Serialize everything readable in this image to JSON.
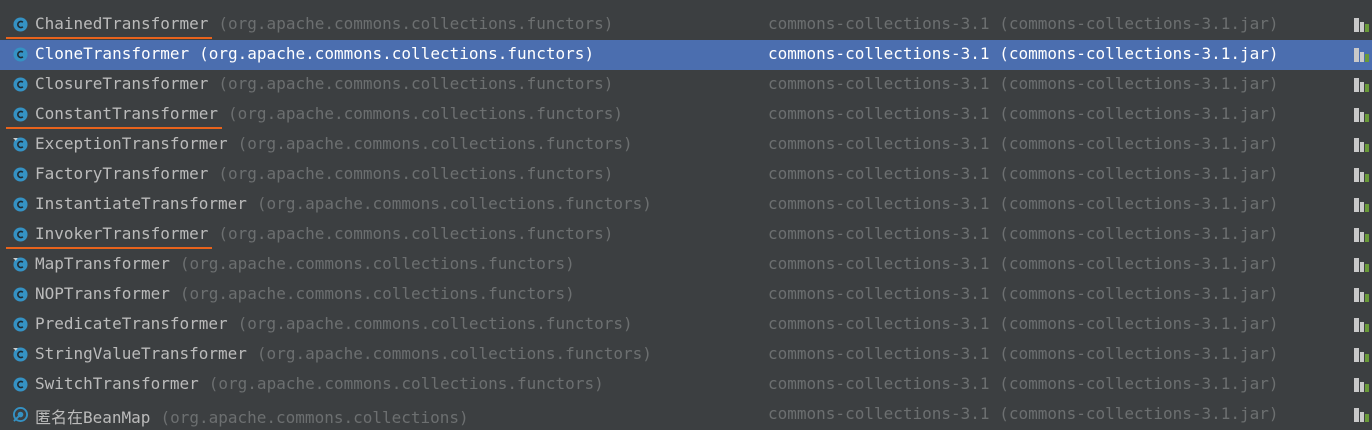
{
  "colors": {
    "background": "#3c3f41",
    "selection": "#4b6eaf",
    "class_icon": "#3592c4",
    "highlight_underline": "#e8631c",
    "primary_text": "#bbbbbb",
    "secondary_text": "#6c6f70"
  },
  "results": [
    {
      "name": "ChainedTransformer",
      "package": "(org.apache.commons.collections.functors)",
      "library": "commons-collections-3.1 (commons-collections-3.1.jar)",
      "icon": "class-icon",
      "selected": false,
      "underlined": true
    },
    {
      "name": "CloneTransformer",
      "package": "(org.apache.commons.collections.functors)",
      "library": "commons-collections-3.1 (commons-collections-3.1.jar)",
      "icon": "class-icon",
      "selected": true,
      "underlined": false
    },
    {
      "name": "ClosureTransformer",
      "package": "(org.apache.commons.collections.functors)",
      "library": "commons-collections-3.1 (commons-collections-3.1.jar)",
      "icon": "class-icon",
      "selected": false,
      "underlined": false
    },
    {
      "name": "ConstantTransformer",
      "package": "(org.apache.commons.collections.functors)",
      "library": "commons-collections-3.1 (commons-collections-3.1.jar)",
      "icon": "class-icon",
      "selected": false,
      "underlined": true
    },
    {
      "name": "ExceptionTransformer",
      "package": "(org.apache.commons.collections.functors)",
      "library": "commons-collections-3.1 (commons-collections-3.1.jar)",
      "icon": "final-class-icon",
      "selected": false,
      "underlined": false
    },
    {
      "name": "FactoryTransformer",
      "package": "(org.apache.commons.collections.functors)",
      "library": "commons-collections-3.1 (commons-collections-3.1.jar)",
      "icon": "class-icon",
      "selected": false,
      "underlined": false
    },
    {
      "name": "InstantiateTransformer",
      "package": "(org.apache.commons.collections.functors)",
      "library": "commons-collections-3.1 (commons-collections-3.1.jar)",
      "icon": "class-icon",
      "selected": false,
      "underlined": false
    },
    {
      "name": "InvokerTransformer",
      "package": "(org.apache.commons.collections.functors)",
      "library": "commons-collections-3.1 (commons-collections-3.1.jar)",
      "icon": "class-icon",
      "selected": false,
      "underlined": true
    },
    {
      "name": "MapTransformer",
      "package": "(org.apache.commons.collections.functors)",
      "library": "commons-collections-3.1 (commons-collections-3.1.jar)",
      "icon": "final-class-icon",
      "selected": false,
      "underlined": false
    },
    {
      "name": "NOPTransformer",
      "package": "(org.apache.commons.collections.functors)",
      "library": "commons-collections-3.1 (commons-collections-3.1.jar)",
      "icon": "class-icon",
      "selected": false,
      "underlined": false
    },
    {
      "name": "PredicateTransformer",
      "package": "(org.apache.commons.collections.functors)",
      "library": "commons-collections-3.1 (commons-collections-3.1.jar)",
      "icon": "class-icon",
      "selected": false,
      "underlined": false
    },
    {
      "name": "StringValueTransformer",
      "package": "(org.apache.commons.collections.functors)",
      "library": "commons-collections-3.1 (commons-collections-3.1.jar)",
      "icon": "final-class-icon",
      "selected": false,
      "underlined": false
    },
    {
      "name": "SwitchTransformer",
      "package": "(org.apache.commons.collections.functors)",
      "library": "commons-collections-3.1 (commons-collections-3.1.jar)",
      "icon": "class-icon",
      "selected": false,
      "underlined": false
    },
    {
      "name": "匿名在BeanMap",
      "package": "(org.apache.commons.collections)",
      "library": "commons-collections-3.1 (commons-collections-3.1.jar)",
      "icon": "anonymous-class-icon",
      "selected": false,
      "underlined": false
    }
  ]
}
